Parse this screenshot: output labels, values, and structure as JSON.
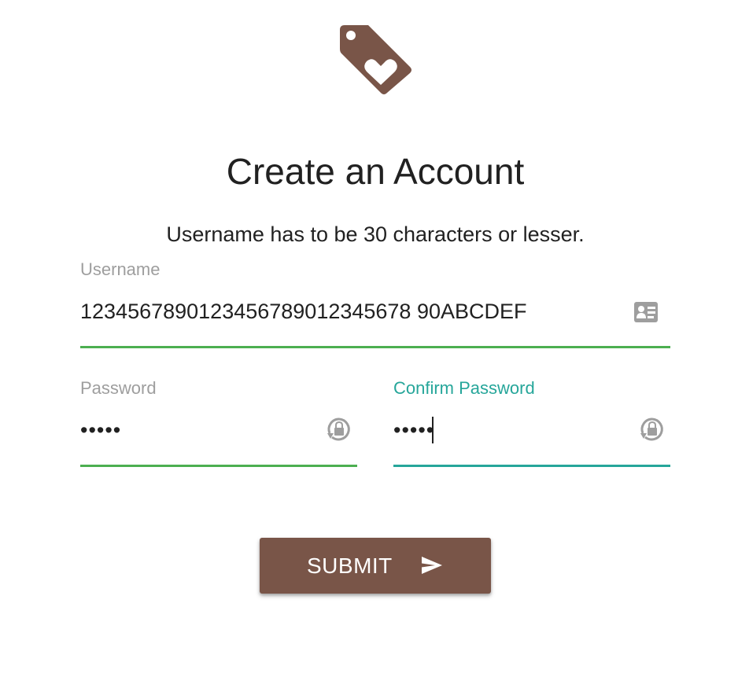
{
  "header": {
    "logo_icon": "tag-heart-icon",
    "title": "Create an Account",
    "hint": "Username has to be 30 characters or lesser."
  },
  "form": {
    "username": {
      "label": "Username",
      "value": "1234567890123456789012345678 90ABCDEF",
      "icon": "contact-card-icon"
    },
    "password": {
      "label": "Password",
      "value": "•••••",
      "icon": "lock-reset-icon"
    },
    "confirm_password": {
      "label": "Confirm Password",
      "value": "•••••",
      "icon": "lock-reset-icon"
    },
    "submit": {
      "label": "SUBMIT",
      "icon": "send-icon"
    }
  },
  "colors": {
    "brand": "#795548",
    "valid_underline": "#4caf50",
    "focus_accent": "#26a69a",
    "label_gray": "#9e9e9e",
    "text": "#212121"
  }
}
